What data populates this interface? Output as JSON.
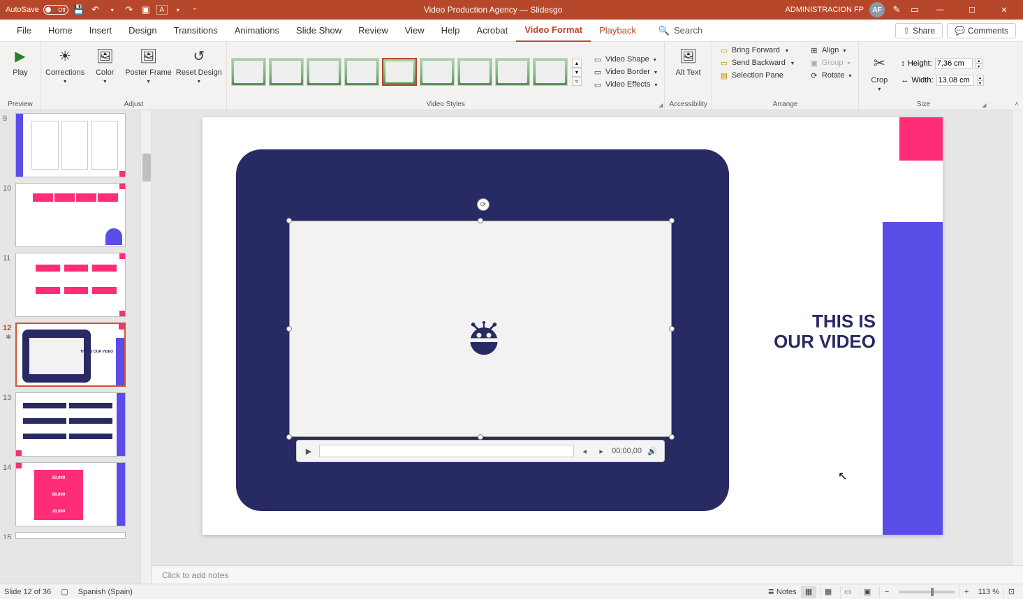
{
  "titlebar": {
    "autosave_label": "AutoSave",
    "autosave_state": "Off",
    "document_title": "Video Production Agency — Slidesgo",
    "account_name": "ADMINISTRACION FP",
    "account_initials": "AF"
  },
  "tabs": {
    "file": "File",
    "home": "Home",
    "insert": "Insert",
    "design": "Design",
    "transitions": "Transitions",
    "animations": "Animations",
    "slideshow": "Slide Show",
    "review": "Review",
    "view": "View",
    "help": "Help",
    "acrobat": "Acrobat",
    "video_format": "Video Format",
    "playback": "Playback",
    "search": "Search",
    "share": "Share",
    "comments": "Comments"
  },
  "ribbon": {
    "preview": {
      "play": "Play",
      "label": "Preview"
    },
    "adjust": {
      "corrections": "Corrections",
      "color": "Color",
      "poster_frame": "Poster Frame",
      "reset_design": "Reset Design",
      "label": "Adjust"
    },
    "video_styles": {
      "video_shape": "Video Shape",
      "video_border": "Video Border",
      "video_effects": "Video Effects",
      "label": "Video Styles"
    },
    "accessibility": {
      "alt_text": "Alt Text",
      "label": "Accessibility"
    },
    "arrange": {
      "bring_forward": "Bring Forward",
      "send_backward": "Send Backward",
      "selection_pane": "Selection Pane",
      "align": "Align",
      "group": "Group",
      "rotate": "Rotate",
      "label": "Arrange"
    },
    "size": {
      "crop": "Crop",
      "height_label": "Height:",
      "height_value": "7,36 cm",
      "width_label": "Width:",
      "width_value": "13,08 cm",
      "label": "Size"
    }
  },
  "thumbnails": {
    "9": "9",
    "10": "10",
    "11": "11",
    "12": "12",
    "13": "13",
    "14": "14",
    "15": "15",
    "t12_title": "THIS IS OUR VIDEO"
  },
  "slide": {
    "title_line1": "THIS IS",
    "title_line2": "OUR VIDEO",
    "timecode": "00:00,00"
  },
  "notes": {
    "placeholder": "Click to add notes"
  },
  "status": {
    "slide_pos": "Slide 12 of 36",
    "language": "Spanish (Spain)",
    "notes_btn": "Notes",
    "zoom": "113 %"
  }
}
